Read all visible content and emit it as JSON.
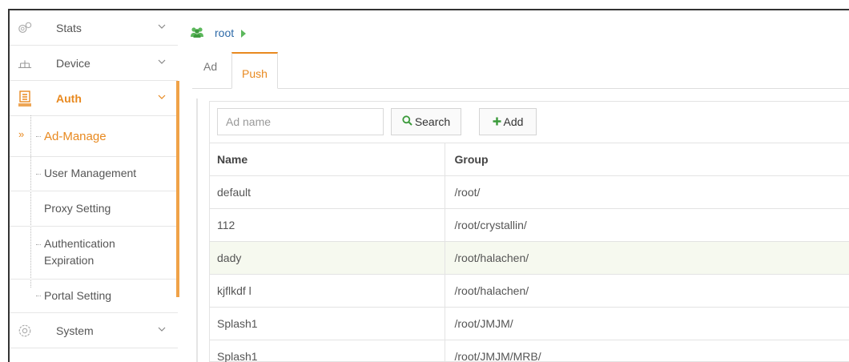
{
  "sidebar": {
    "items": [
      {
        "label": "Stats",
        "icon": "stats-gear-icon"
      },
      {
        "label": "Device",
        "icon": "device-network-icon"
      },
      {
        "label": "Auth",
        "icon": "auth-building-icon",
        "active": true
      },
      {
        "label": "System",
        "icon": "system-gear-icon"
      }
    ],
    "sub_items": [
      {
        "label": "Ad-Manage",
        "active": true
      },
      {
        "label": "User Management"
      },
      {
        "label": "Proxy Setting"
      },
      {
        "label": "Authentication Expiration"
      },
      {
        "label": "Portal Setting"
      }
    ]
  },
  "breadcrumb": {
    "label": "root",
    "icon": "users-group-icon"
  },
  "tabs": [
    {
      "label": "Ad"
    },
    {
      "label": "Push",
      "active": true
    }
  ],
  "toolbar": {
    "search_placeholder": "Ad name",
    "search_label": "Search",
    "add_label": "Add"
  },
  "table": {
    "columns": [
      "Name",
      "Group"
    ],
    "rows": [
      {
        "name": "default",
        "group": "/root/"
      },
      {
        "name": "112",
        "group": "/root/crystallin/"
      },
      {
        "name": "dady",
        "group": "/root/halachen/"
      },
      {
        "name": "kjflkdf l",
        "group": "/root/halachen/"
      },
      {
        "name": "Splash1",
        "group": "/root/JMJM/"
      },
      {
        "name": "Splash1",
        "group": "/root/JMJM/MRB/"
      }
    ]
  },
  "colors": {
    "accent": "#e8891f",
    "link": "#2d6aa8",
    "green": "#5cb85c",
    "highlight_row": "#f6f9ef"
  }
}
